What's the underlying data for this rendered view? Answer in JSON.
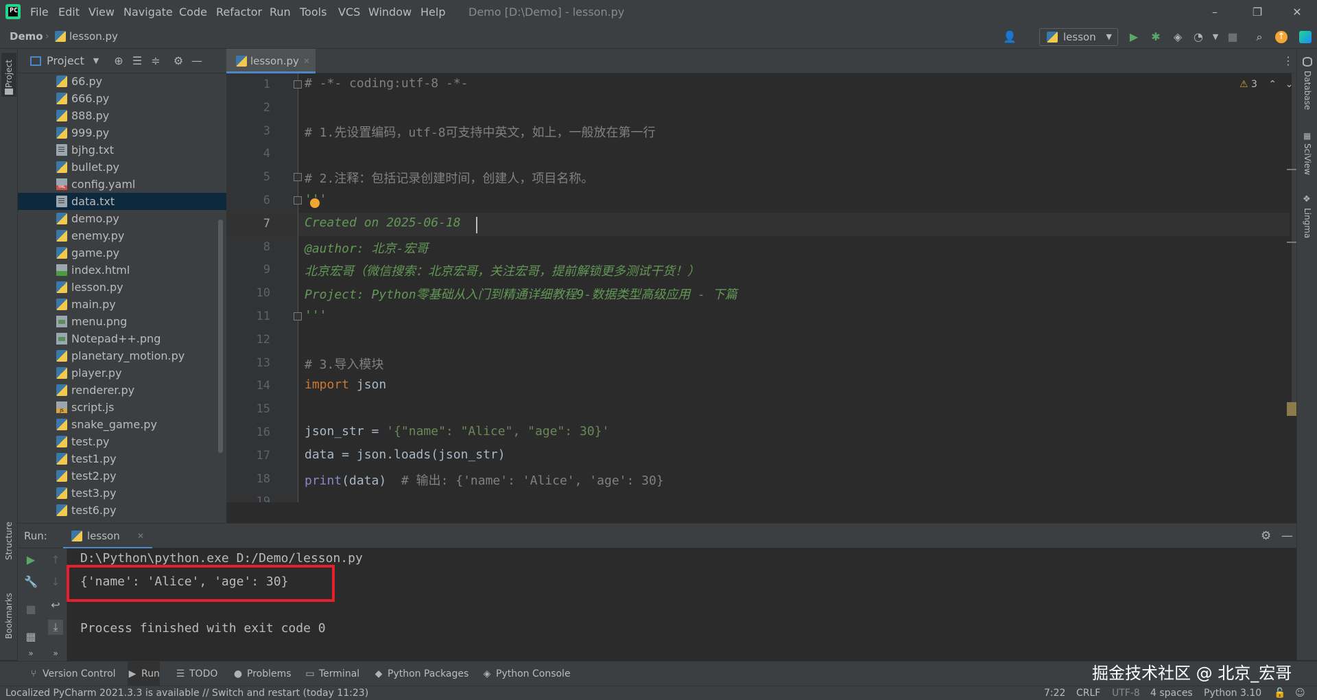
{
  "menu": [
    "File",
    "Edit",
    "View",
    "Navigate",
    "Code",
    "Refactor",
    "Run",
    "Tools",
    "VCS",
    "Window",
    "Help"
  ],
  "window_title": "Demo [D:\\Demo] - lesson.py",
  "window_controls": {
    "minimize": "–",
    "restore": "❐",
    "close": "✕"
  },
  "breadcrumb": {
    "project": "Demo",
    "file": "lesson.py"
  },
  "toolbar": {
    "run_config": "lesson"
  },
  "project_panel": {
    "title": "Project",
    "files": [
      {
        "name": "66.py",
        "type": "py"
      },
      {
        "name": "666.py",
        "type": "py"
      },
      {
        "name": "888.py",
        "type": "py"
      },
      {
        "name": "999.py",
        "type": "py"
      },
      {
        "name": "bjhg.txt",
        "type": "txt"
      },
      {
        "name": "bullet.py",
        "type": "py"
      },
      {
        "name": "config.yaml",
        "type": "yaml"
      },
      {
        "name": "data.txt",
        "type": "txt",
        "selected": true
      },
      {
        "name": "demo.py",
        "type": "py"
      },
      {
        "name": "enemy.py",
        "type": "py"
      },
      {
        "name": "game.py",
        "type": "py"
      },
      {
        "name": "index.html",
        "type": "html"
      },
      {
        "name": "lesson.py",
        "type": "py"
      },
      {
        "name": "main.py",
        "type": "py"
      },
      {
        "name": "menu.png",
        "type": "png"
      },
      {
        "name": "Notepad++.png",
        "type": "png"
      },
      {
        "name": "planetary_motion.py",
        "type": "py"
      },
      {
        "name": "player.py",
        "type": "py"
      },
      {
        "name": "renderer.py",
        "type": "py"
      },
      {
        "name": "script.js",
        "type": "js"
      },
      {
        "name": "snake_game.py",
        "type": "py"
      },
      {
        "name": "test.py",
        "type": "py"
      },
      {
        "name": "test1.py",
        "type": "py"
      },
      {
        "name": "test2.py",
        "type": "py"
      },
      {
        "name": "test3.py",
        "type": "py"
      },
      {
        "name": "test6.py",
        "type": "py"
      }
    ]
  },
  "editor": {
    "tab": "lesson.py",
    "warnings": "3",
    "current_line": 7,
    "lines": [
      {
        "n": "1",
        "parts": [
          {
            "t": "# -*- coding:utf-8 -*-",
            "c": "com"
          }
        ]
      },
      {
        "n": "2",
        "parts": []
      },
      {
        "n": "3",
        "parts": [
          {
            "t": "# 1.先设置编码，utf-8可支持中英文，如上，一般放在第一行",
            "c": "com"
          }
        ]
      },
      {
        "n": "4",
        "parts": []
      },
      {
        "n": "5",
        "parts": [
          {
            "t": "# 2.注释：包括记录创建时间，创建人，项目名称。",
            "c": "com"
          }
        ]
      },
      {
        "n": "6",
        "parts": [
          {
            "t": "'''",
            "c": "doc"
          }
        ]
      },
      {
        "n": "7",
        "parts": [
          {
            "t": "Created on 2025-06-18",
            "c": "doc"
          }
        ]
      },
      {
        "n": "8",
        "parts": [
          {
            "t": "@author: 北京-宏哥",
            "c": "doc"
          }
        ]
      },
      {
        "n": "9",
        "parts": [
          {
            "t": "北京宏哥（微信搜索：北京宏哥，关注宏哥，提前解锁更多测试干货！）",
            "c": "doc"
          }
        ]
      },
      {
        "n": "10",
        "parts": [
          {
            "t": "Project: Python零基础从入门到精通详细教程9-数据类型高级应用 - 下篇",
            "c": "doc"
          }
        ]
      },
      {
        "n": "11",
        "parts": [
          {
            "t": "'''",
            "c": "doc"
          }
        ]
      },
      {
        "n": "12",
        "parts": []
      },
      {
        "n": "13",
        "parts": [
          {
            "t": "# 3.导入模块",
            "c": "com"
          }
        ]
      },
      {
        "n": "14",
        "parts": [
          {
            "t": "import",
            "c": "kw"
          },
          {
            "t": " json",
            "c": "plain"
          }
        ]
      },
      {
        "n": "15",
        "parts": []
      },
      {
        "n": "16",
        "parts": [
          {
            "t": "json_str = ",
            "c": "plain"
          },
          {
            "t": "'{\"name\": \"Alice\", \"age\": 30}'",
            "c": "str"
          }
        ]
      },
      {
        "n": "17",
        "parts": [
          {
            "t": "data = json.loads(json_str)",
            "c": "plain"
          }
        ]
      },
      {
        "n": "18",
        "parts": [
          {
            "t": "print",
            "c": "builtin"
          },
          {
            "t": "(data)  ",
            "c": "plain"
          },
          {
            "t": "# 输出: {'name': 'Alice', 'age': 30}",
            "c": "com"
          }
        ]
      },
      {
        "n": "19",
        "parts": []
      }
    ]
  },
  "run_panel": {
    "label": "Run:",
    "tab": "lesson",
    "output": [
      "D:\\Python\\python.exe D:/Demo/lesson.py",
      "{'name': 'Alice', 'age': 30}",
      "",
      "Process finished with exit code 0"
    ]
  },
  "side_labels": {
    "left": [
      "Project",
      "Structure",
      "Bookmarks"
    ],
    "right": [
      "Database",
      "SciView",
      "Lingma"
    ]
  },
  "bottom_tabs": [
    "Version Control",
    "Run",
    "TODO",
    "Problems",
    "Terminal",
    "Python Packages",
    "Python Console"
  ],
  "status": {
    "message": "Localized PyCharm 2021.3.3 is available // Switch and restart (today 11:23)",
    "position": "7:22",
    "line_sep": "CRLF",
    "encoding": "UTF-8",
    "indent": "4 spaces",
    "interpreter": "Python 3.10"
  },
  "watermark": "掘金技术社区 @ 北京_宏哥"
}
